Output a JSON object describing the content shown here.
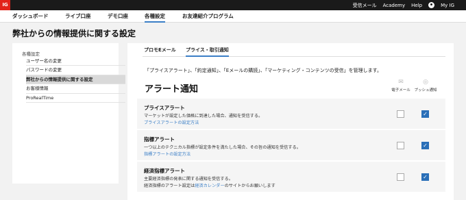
{
  "topbar": {
    "logo": "IG",
    "links": [
      "受信メール",
      "Academy",
      "Help"
    ],
    "user_label": "My IG"
  },
  "nav": {
    "items": [
      "ダッシュボード",
      "ライブ口座",
      "デモ口座",
      "各種設定",
      "お友達紹介プログラム"
    ],
    "active": "各種設定"
  },
  "page": {
    "title": "弊社からの情報提供に関する設定"
  },
  "sidebar": {
    "heading": "各種設定",
    "items": [
      {
        "label": "ユーザー名の変更"
      },
      {
        "label": "パスワードの変更"
      },
      {
        "label": "弊社からの情報提供に関する設定",
        "active": true
      },
      {
        "label": "お客様情報"
      },
      {
        "label": "ProRealTime"
      }
    ]
  },
  "tabs": {
    "items": [
      "プロモEメール",
      "プライス・取引通知"
    ],
    "active": "プライス・取引通知"
  },
  "intro": "「プライスアラート」、「約定通知」、「Eメールの購読」、「マーケティング・コンテンツの受信」を管理します。",
  "section": {
    "title": "アラート通知",
    "col_email": "電子メール",
    "col_push": "プッシュ通知"
  },
  "alerts": [
    {
      "title": "プライスアラート",
      "desc": "マーケットが設定した価格に到達した場合、通知を受信する。",
      "link": "プライスアラートの設定方法",
      "email": false,
      "push": true
    },
    {
      "title": "指標アラート",
      "desc": "一つ以上のテクニカル指標が設定条件を満たした場合、その旨の通知を受信する。",
      "link": "指標アラートの設定方法",
      "email": false,
      "push": true
    },
    {
      "title": "経済指標アラート",
      "desc": "主要経済指標の発表に関する通知を受信する。",
      "desc2_pre": "経済指標のアラート設定は",
      "desc2_link": "経済カレンダー",
      "desc2_post": "のサイトからお願いします",
      "email": false,
      "push": true
    }
  ],
  "colors": {
    "accent": "#3a7ec6",
    "checkbox": "#2a6fb8",
    "brand": "#e2231a"
  }
}
